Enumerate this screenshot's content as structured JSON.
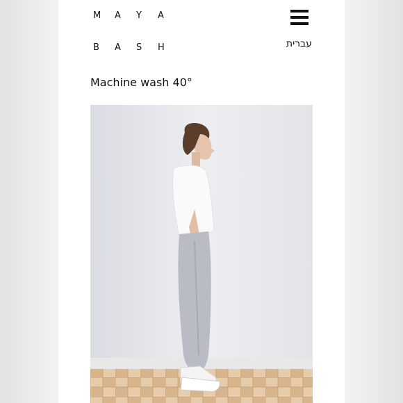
{
  "brand": {
    "line1": [
      "M",
      "A",
      "Y",
      "A"
    ],
    "line2": [
      "B",
      "A",
      "S",
      "H"
    ]
  },
  "header": {
    "menu_icon": "hamburger-menu-icon",
    "language_link": "עברית"
  },
  "content": {
    "care_instruction": "Machine wash 40°",
    "photo_icon": "product-photo"
  }
}
